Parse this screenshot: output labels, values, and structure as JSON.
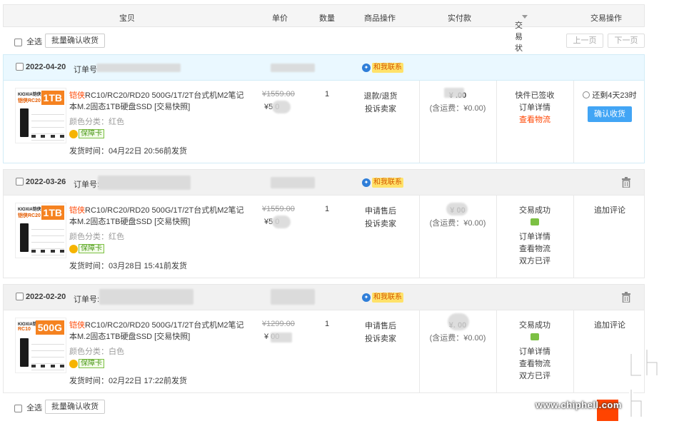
{
  "header": {
    "item": "宝贝",
    "price": "单价",
    "qty": "数量",
    "ops": "商品操作",
    "paid": "实付款",
    "status": "交易状态",
    "action": "交易操作"
  },
  "toolbar_top": {
    "select_all": "全选",
    "batch_confirm": "批量确认收货",
    "prev": "上一页",
    "next": "下一页"
  },
  "toolbar_bottom": {
    "select_all": "全选",
    "batch_confirm": "批量确认收货"
  },
  "contact_label": "和我联系",
  "orders": [
    {
      "date": "2022-04-20",
      "order_no_label": "订单号",
      "brand": "KIOXIA铠侠",
      "model": "铠侠RC20",
      "capacity": "1TB",
      "title_red": "铠侠",
      "title_rest": "RC10/RC20/RD20 500G/1T/2T台式机M2笔记本M.2固态1TB硬盘SSD [交易快照]",
      "attr": "颜色分类：红色",
      "badge": "保障卡",
      "ship": "发货时间：04月22日 20:56前发货",
      "price_old": "¥1559.00",
      "price_new": "¥5        0",
      "qty": "1",
      "ops": [
        "退款/退货",
        "投诉卖家"
      ],
      "paid": "¥      .00",
      "fee": "(含运费：¥0.00)",
      "status": [
        "快件已签收",
        "订单详情"
      ],
      "status_red": "查看物流",
      "remain": "还剩4天23时",
      "confirm": "确认收货"
    },
    {
      "date": "2022-03-26",
      "order_no_label": "订单号:",
      "brand": "KIOXIA铠侠",
      "model": "铠侠RC20",
      "capacity": "1TB",
      "title_red": "铠侠",
      "title_rest": "RC10/RC20/RD20 500G/1T/2T台式机M2笔记本M.2固态1TB硬盘SSD [交易快照]",
      "attr": "颜色分类：红色",
      "badge": "保障卡",
      "ship": "发货时间：03月28日 15:41前发货",
      "price_old": "¥1559.00",
      "price_new": "¥5        0",
      "qty": "1",
      "ops": [
        "申请售后",
        "投诉卖家"
      ],
      "paid": "¥      00",
      "fee": "(含运费：¥0.00)",
      "status_top": "交易成功",
      "status": [
        "订单详情",
        "查看物流",
        "双方已评"
      ],
      "action_text": "追加评论"
    },
    {
      "date": "2022-02-20",
      "order_no_label": "订单号:",
      "brand": "KIOXIA铠侠",
      "model": "RC10",
      "capacity": "500G",
      "title_red": "铠侠",
      "title_rest": "RC10/RC20/RD20 500G/1T/2T台式机M2笔记本M.2固态1TB硬盘SSD [交易快照]",
      "attr": "颜色分类：白色",
      "badge": "保障卡",
      "ship": "发货时间：02月22日 17:22前发货",
      "price_old": "¥1299.00",
      "price_new": "¥       00",
      "qty": "1",
      "ops": [
        "申请售后",
        "投诉卖家"
      ],
      "paid": "¥.      00",
      "fee": "(含运费：¥0.00)",
      "status_top": "交易成功",
      "status": [
        "订单详情",
        "查看物流",
        "双方已评"
      ],
      "action_text": "追加评论"
    }
  ],
  "watermark": "www.chiphell.com",
  "colors": {
    "accent_red": "#ff4400",
    "confirm_blue": "#42a5f5",
    "highlight_bg": "#eaf8ff"
  }
}
